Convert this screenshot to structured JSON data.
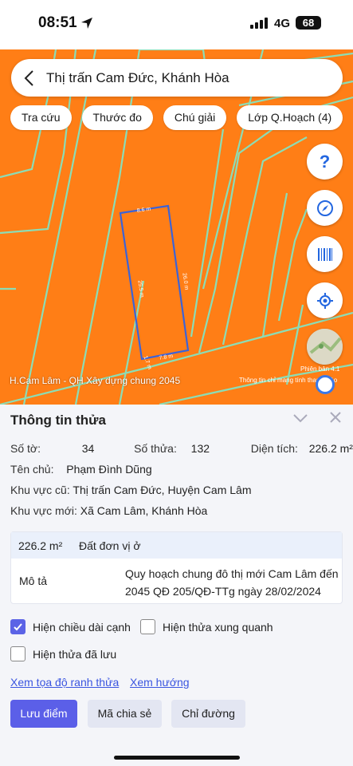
{
  "status": {
    "time": "08:51",
    "network": "4G",
    "battery": "68"
  },
  "search": {
    "text": "Thị trấn Cam Đức, Khánh Hòa"
  },
  "chips": [
    "Tra cứu",
    "Thước đo",
    "Chú giải",
    "Lớp Q.Hoạch (4)"
  ],
  "map": {
    "help": "?",
    "caption": "H.Cam Lâm - QH Xây dựng chung 2045",
    "version": "Phiên bản 4.1",
    "note": "Thông tin chỉ mang tính tham khảo",
    "dimensions": [
      "8.6 m",
      "26.0 m",
      "25.5 m",
      "7.8 m",
      "1.7 m"
    ],
    "accent": "#ff7e16"
  },
  "sheet": {
    "title": "Thông tin thửa",
    "so_to_label": "Số tờ:",
    "so_to": "34",
    "so_thua_label": "Số thửa:",
    "so_thua": "132",
    "dien_tich_label": "Diện tích:",
    "dien_tich": "226.2 m²",
    "ten_chu_label": "Tên chủ:",
    "ten_chu": "Phạm Đình Dũng",
    "kv_cu_label": "Khu vực cũ:",
    "kv_cu": "Thị trấn Cam Đức, Huyện Cam Lâm",
    "kv_moi_label": "Khu vực mới:",
    "kv_moi": "Xã Cam Lâm, Khánh Hòa",
    "box_area": "226.2 m²",
    "box_type": "Đất đơn vị ở",
    "box_desc_label": "Mô tả",
    "box_desc": "Quy hoạch chung đô thị mới Cam Lâm đến 2045 QĐ 205/QĐ-TTg ngày 28/02/2024",
    "cb1": "Hiện chiều dài cạnh",
    "cb2": "Hiện thửa xung quanh",
    "cb3": "Hiện thửa đã lưu",
    "link1": "Xem tọa độ ranh thửa",
    "link2": "Xem hướng",
    "btn_save": "Lưu điểm",
    "btn_share": "Mã chia sẻ",
    "btn_route": "Chỉ đường"
  }
}
